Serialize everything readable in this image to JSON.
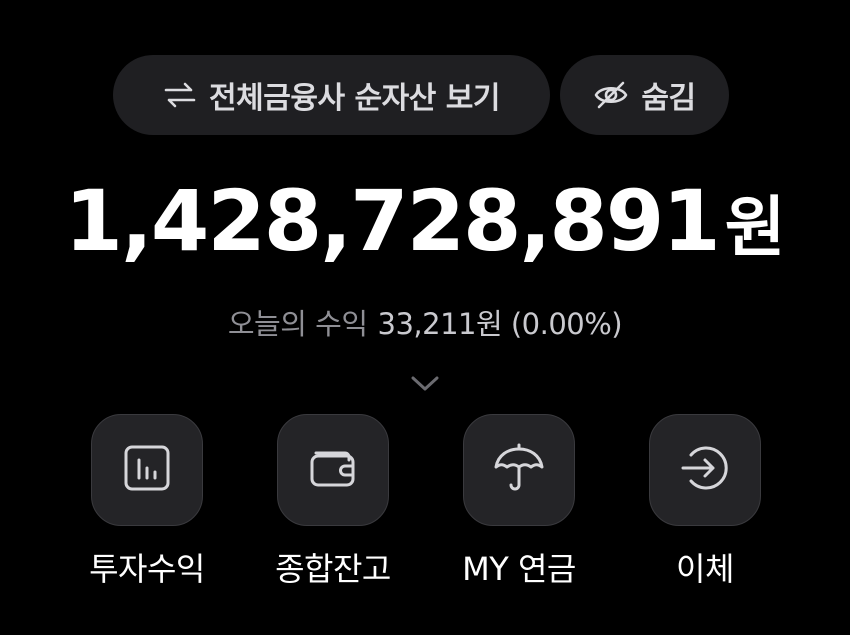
{
  "header": {
    "net_assets_button": {
      "label": "전체금융사 순자산 보기",
      "icon": "swap-arrows-icon"
    },
    "hide_button": {
      "label": "숨김",
      "icon": "eye-off-icon"
    }
  },
  "summary": {
    "total_amount": "1,428,728,891",
    "total_unit": "원",
    "today_profit_label": "오늘의 수익",
    "today_profit_value": "33,211원 (0.00%)",
    "expand_icon": "chevron-down-icon"
  },
  "actions": [
    {
      "label": "투자수익",
      "icon": "bar-chart-icon"
    },
    {
      "label": "종합잔고",
      "icon": "wallet-icon"
    },
    {
      "label": "MY 연금",
      "icon": "umbrella-icon"
    },
    {
      "label": "이체",
      "icon": "transfer-arrow-icon"
    }
  ],
  "colors": {
    "background": "#000000",
    "pill_background": "#1f1f22",
    "tile_background": "#242427",
    "primary_text": "#ffffff",
    "secondary_text": "#8f8f95"
  }
}
